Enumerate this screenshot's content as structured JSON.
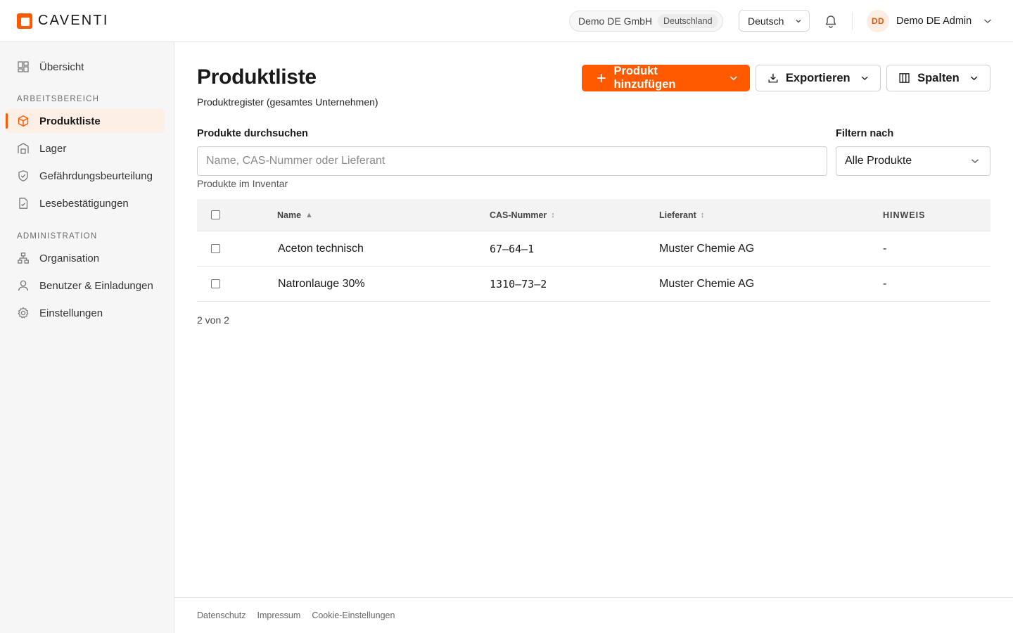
{
  "brand": {
    "name": "CAVENTI",
    "accent": "#ff5a00"
  },
  "header": {
    "org_name": "Demo DE GmbH",
    "org_country": "Deutschland",
    "language": "Deutsch",
    "user_initials": "DD",
    "user_name": "Demo DE Admin",
    "icons": [
      "chevron-down-icon",
      "bell-icon"
    ]
  },
  "sidebar": {
    "overview": "Übersicht",
    "section_work": "ARBEITSBEREICH",
    "items_work": [
      {
        "label": "Produktliste",
        "icon": "box-icon",
        "active": true
      },
      {
        "label": "Lager",
        "icon": "warehouse-icon"
      },
      {
        "label": "Gefährdungsbeurteilung",
        "icon": "shield-icon"
      },
      {
        "label": "Lesebestätigungen",
        "icon": "document-check-icon"
      }
    ],
    "section_admin": "ADMINISTRATION",
    "items_admin": [
      {
        "label": "Organisation",
        "icon": "org-chart-icon"
      },
      {
        "label": "Benutzer & Einladungen",
        "icon": "user-icon"
      },
      {
        "label": "Einstellungen",
        "icon": "gear-icon"
      }
    ]
  },
  "main": {
    "title": "Produktliste",
    "subtitle": "Produktregister (gesamtes Unternehmen)",
    "add_button": "Produkt hinzufügen",
    "export_button": "Exportieren",
    "columns_button": "Spalten",
    "search_label": "Produkte durchsuchen",
    "search_placeholder": "Name, CAS-Nummer oder Lieferant",
    "search_value": "",
    "filter_label": "Filtern nach",
    "filter_value": "Alle Produkte",
    "hint": "Produkte im Inventar",
    "table": {
      "headers": {
        "name": "Name",
        "cas": "CAS-Nummer",
        "supplier": "Lieferant",
        "note": "HINWEIS"
      },
      "rows": [
        {
          "name": "Aceton technisch",
          "cas": "67–64–1",
          "supplier": "Muster Chemie AG",
          "note": "-"
        },
        {
          "name": "Natronlauge 30%",
          "cas": "1310–73–2",
          "supplier": "Muster Chemie AG",
          "note": "-"
        }
      ]
    },
    "count": "2 von 2"
  },
  "footer": {
    "links": [
      "Datenschutz",
      "Impressum",
      "Cookie-Einstellungen"
    ]
  }
}
